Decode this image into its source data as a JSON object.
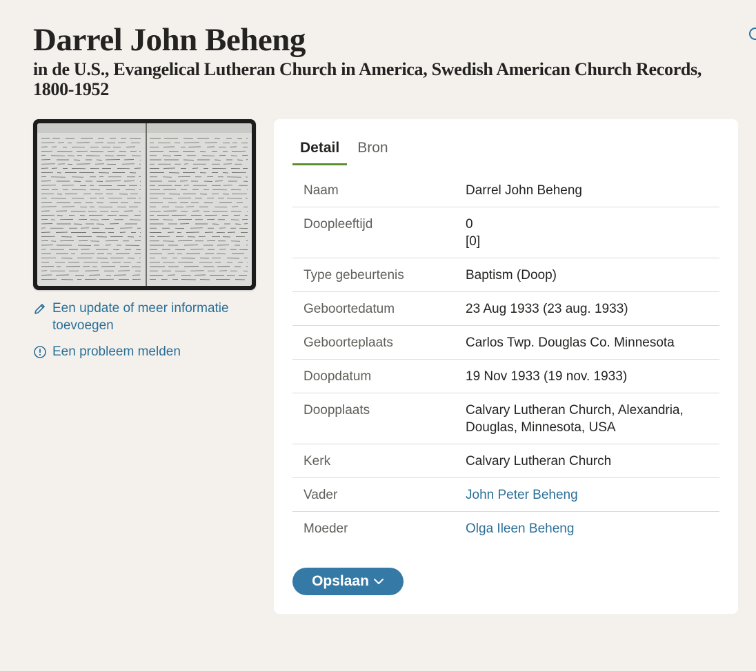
{
  "header": {
    "title": "Darrel John Beheng",
    "subtitle": "in de U.S., Evangelical Lutheran Church in America, Swedish American Church Records, 1800-1952"
  },
  "sidebar": {
    "update_link": "Een update of meer informatie toevoegen",
    "report_link": "Een probleem melden"
  },
  "tabs": [
    {
      "label": "Detail",
      "active": true
    },
    {
      "label": "Bron",
      "active": false
    }
  ],
  "details": [
    {
      "label": "Naam",
      "value": [
        "Darrel John Beheng"
      ]
    },
    {
      "label": "Doopleeftijd",
      "value": [
        "0",
        "[0]"
      ]
    },
    {
      "label": "Type gebeurtenis",
      "value": [
        "Baptism (Doop)"
      ]
    },
    {
      "label": "Geboortedatum",
      "value": [
        "23 Aug 1933 (23 aug. 1933)"
      ]
    },
    {
      "label": "Geboorteplaats",
      "value": [
        "Carlos Twp. Douglas Co. Minnesota"
      ]
    },
    {
      "label": "Doopdatum",
      "value": [
        "19 Nov 1933 (19 nov. 1933)"
      ]
    },
    {
      "label": "Doopplaats",
      "value": [
        "Calvary Lutheran Church, Alexandria, Douglas, Minnesota, USA"
      ]
    },
    {
      "label": "Kerk",
      "value": [
        "Calvary Lutheran Church"
      ]
    },
    {
      "label": "Vader",
      "value": [
        "John Peter Beheng"
      ],
      "link": true
    },
    {
      "label": "Moeder",
      "value": [
        "Olga Ileen Beheng"
      ],
      "link": true
    }
  ],
  "save_button": {
    "label": "Opslaan",
    "icon": "chevron-down-icon"
  },
  "colors": {
    "link": "#2a6f97",
    "accent_tab": "#5f8f2c",
    "button": "#357aa6",
    "background": "#f4f1ed"
  }
}
